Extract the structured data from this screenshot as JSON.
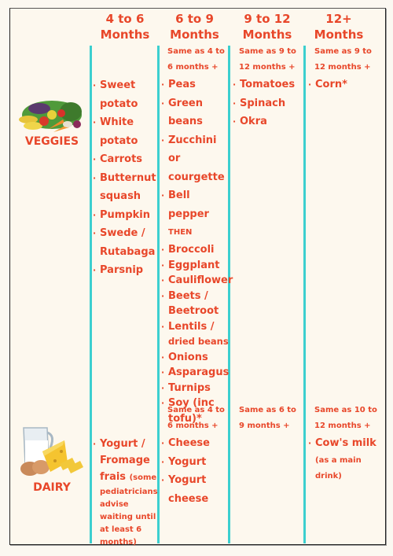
{
  "headers": [
    {
      "line1": "4 to 6",
      "line2": "Months"
    },
    {
      "line1": "6 to 9",
      "line2": "Months"
    },
    {
      "line1": "9 to 12",
      "line2": "Months"
    },
    {
      "line1": "12+",
      "line2": "Months"
    }
  ],
  "veggies": {
    "label": "VEGGIES",
    "icon": "vegetables-illustration",
    "col1": {
      "items": [
        "Sweet",
        "potato",
        "White",
        "potato",
        "Carrots",
        "Butternut",
        "squash",
        "Pumpkin",
        "Swede /",
        "Rutabaga",
        "Parsnip"
      ]
    },
    "col2": {
      "same_line1": "Same as 4 to",
      "same_line2": "6 months +",
      "items_a": [
        "Peas",
        "Green",
        "beans",
        "Zucchini or",
        "courgette",
        "Bell pepper"
      ],
      "then": "THEN",
      "items_b": [
        "Broccoli",
        "Eggplant",
        "Cauliflower",
        "Beets /",
        "Beetroot",
        "Lentils /",
        "dried beans",
        "Onions",
        "Asparagus",
        "Turnips",
        "Soy (inc",
        "tofu)*"
      ]
    },
    "col3": {
      "same_line1": "Same as 9 to",
      "same_line2": "12 months +",
      "items": [
        "Tomatoes",
        "Spinach",
        "Okra"
      ]
    },
    "col4": {
      "same_line1": "Same as 9 to",
      "same_line2": "12 months +",
      "items": [
        "Corn*"
      ]
    }
  },
  "dairy": {
    "label": "DAIRY",
    "icon": "dairy-illustration",
    "col1": {
      "lines": [
        "Yogurt /",
        "Fromage",
        "frais",
        "(some",
        "pediatricians",
        "advise",
        "waiting until",
        "at least 6",
        "months)"
      ]
    },
    "col2": {
      "same_line1": "Same as 4 to",
      "same_line2": "6 months +",
      "items": [
        "Cheese",
        "Yogurt",
        "Yogurt",
        "cheese"
      ]
    },
    "col3": {
      "same_line1": "Same as 6 to",
      "same_line2": "9 months +"
    },
    "col4": {
      "same_line1": "Same as 10 to",
      "same_line2": "12 months +",
      "items": [
        "Cow's milk"
      ],
      "note_line1": "(as a main",
      "note_line2": "drink)"
    }
  },
  "colors": {
    "text": "#e8472a",
    "divider": "#3ccfcf",
    "background": "#fdf8ee"
  }
}
